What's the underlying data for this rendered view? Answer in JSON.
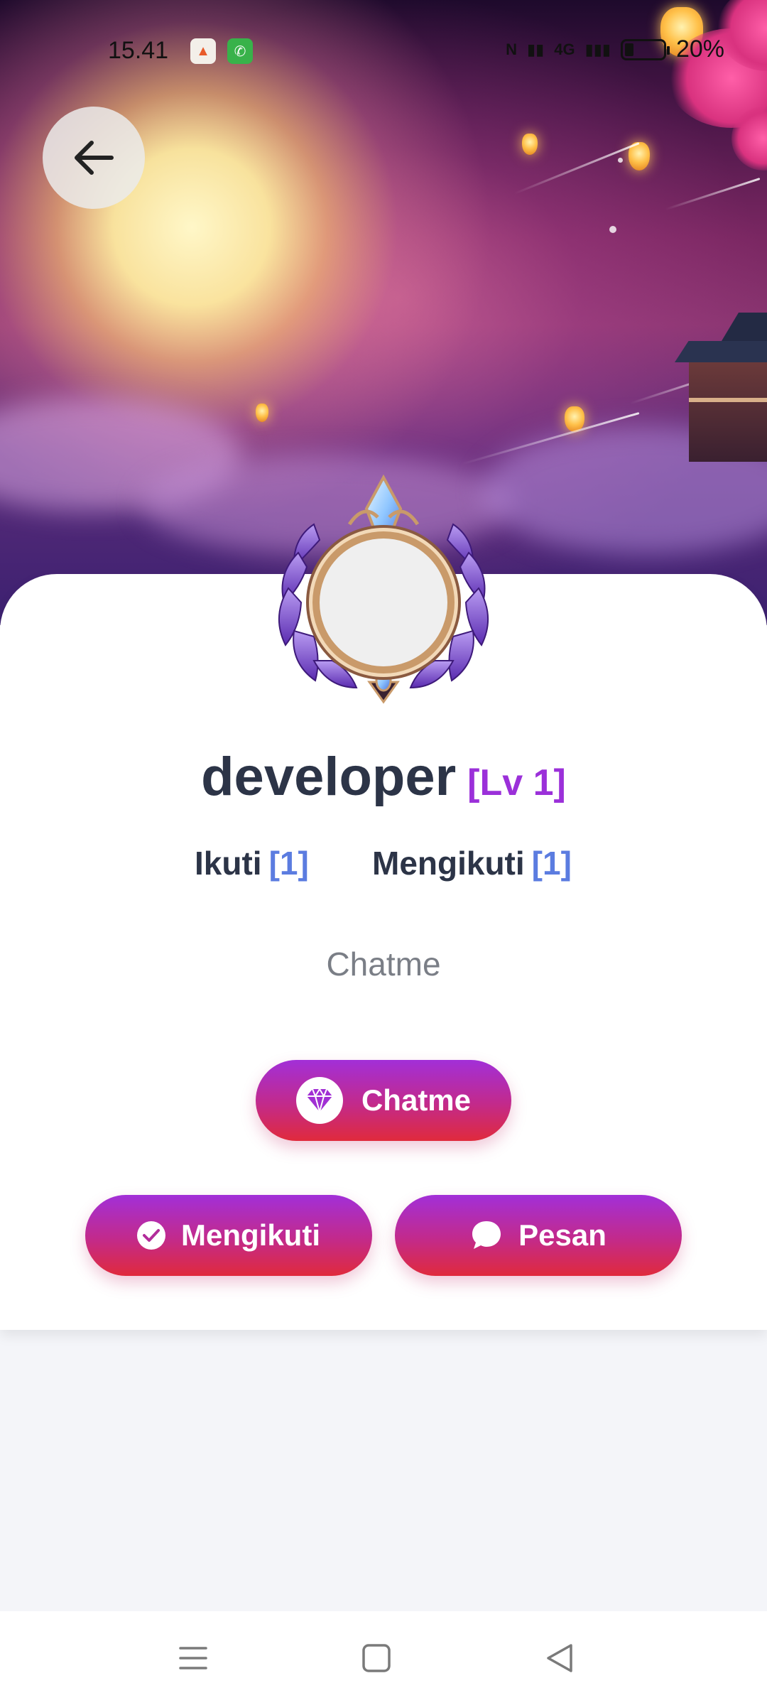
{
  "status_bar": {
    "time": "15.41",
    "network": "4G",
    "battery_percent": "20%"
  },
  "profile": {
    "username": "developer",
    "level": "[Lv 1]",
    "following_label": "Ikuti",
    "following_count": "[1]",
    "followers_label": "Mengikuti",
    "followers_count": "[1]",
    "bio": "Chatme"
  },
  "actions": {
    "chatme_label": "Chatme",
    "follow_label": "Mengikuti",
    "message_label": "Pesan"
  },
  "icons": {
    "back": "arrow-left-icon",
    "chatme": "diamond-icon",
    "follow": "check-circle-icon",
    "message": "chat-bubble-icon",
    "nav_menu": "menu-icon",
    "nav_home": "square-icon",
    "nav_back": "triangle-back-icon"
  },
  "colors": {
    "accent_gradient_top": "#a22fd8",
    "accent_gradient_bottom": "#e02a3c",
    "level_color": "#9b30d9",
    "count_color": "#5b7ce0",
    "text_dark": "#2c3447"
  }
}
